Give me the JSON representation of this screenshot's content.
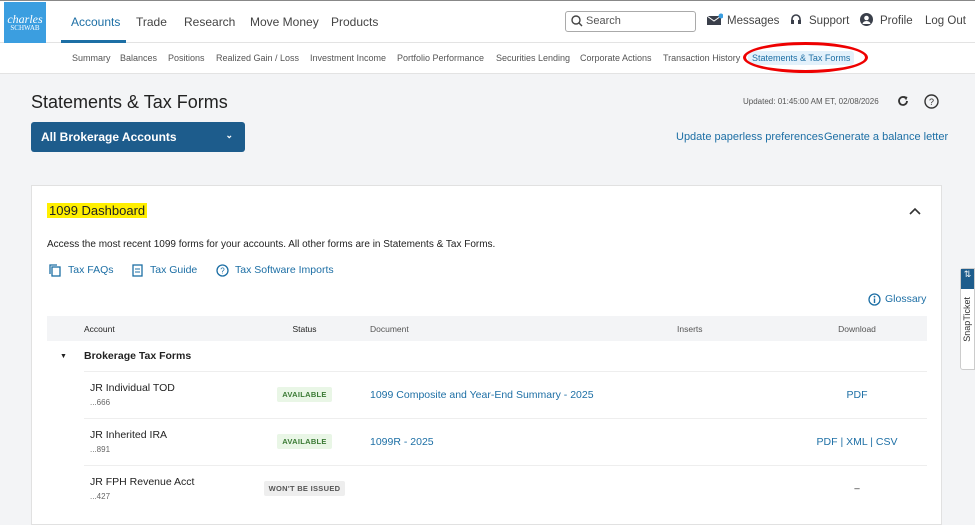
{
  "brand": {
    "line1": "charles",
    "line2": "SCHWAB"
  },
  "nav": [
    "Accounts",
    "Trade",
    "Research",
    "Move Money",
    "Products"
  ],
  "search": {
    "placeholder": "Search"
  },
  "top_right": {
    "messages": "Messages",
    "support": "Support",
    "profile": "Profile",
    "logout": "Log Out"
  },
  "subnav": [
    "Summary",
    "Balances",
    "Positions",
    "Realized Gain / Loss",
    "Investment Income",
    "Portfolio Performance",
    "Securities Lending",
    "Corporate Actions",
    "Transaction History",
    "Statements & Tax Forms"
  ],
  "page": {
    "title": "Statements & Tax Forms",
    "updated": "Updated: 01:45:00 AM ET, 02/08/2026",
    "account_select": "All Brokerage Accounts",
    "link_paperless": "Update paperless preferences",
    "link_balance": "Generate a balance letter"
  },
  "dashboard": {
    "title": "1099 Dashboard",
    "description": "Access the most recent 1099 forms for your accounts. All other forms are in Statements & Tax Forms.",
    "links": [
      "Tax FAQs",
      "Tax Guide",
      "Tax Software Imports"
    ],
    "glossary": "Glossary",
    "columns": [
      "Account",
      "Status",
      "Document",
      "Inserts",
      "Download"
    ],
    "group": "Brokerage Tax Forms",
    "rows": [
      {
        "account": "JR Individual TOD",
        "number": "...666",
        "status": "AVAILABLE",
        "document": "1099 Composite and Year-End Summary - 2025",
        "downloads": [
          "PDF"
        ]
      },
      {
        "account": "JR Inherited IRA",
        "number": "...891",
        "status": "AVAILABLE",
        "document": "1099R - 2025",
        "downloads": [
          "PDF",
          "XML",
          "CSV"
        ]
      },
      {
        "account": "JR FPH Revenue Acct",
        "number": "...427",
        "status": "WON'T BE ISSUED",
        "document": "",
        "downloads": [
          "–"
        ]
      }
    ]
  },
  "snapticket": {
    "label": "SnapTicket",
    "symbol": "⇅"
  }
}
